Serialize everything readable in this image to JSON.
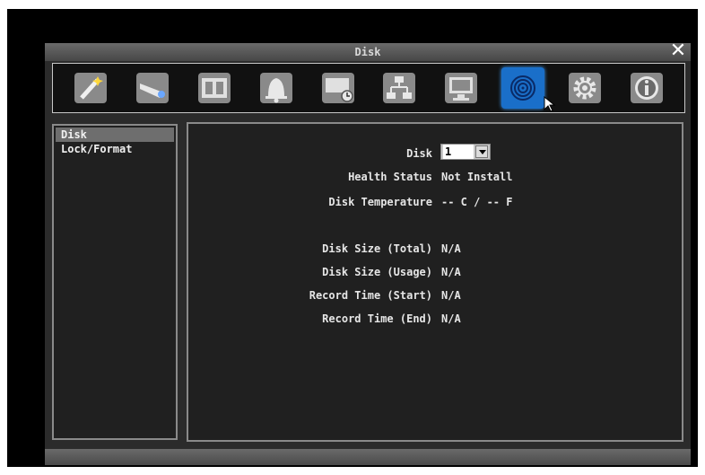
{
  "window": {
    "title": "Disk",
    "close_label": "✕"
  },
  "toolbar": {
    "icons": [
      "wizard-icon",
      "camera-icon",
      "film-icon",
      "alarm-bell-icon",
      "schedule-icon",
      "network-icon",
      "display-icon",
      "disk-icon",
      "gear-icon",
      "info-icon"
    ],
    "active": "disk-icon"
  },
  "sidebar": {
    "items": [
      {
        "label": "Disk",
        "selected": true
      },
      {
        "label": "Lock/Format",
        "selected": false
      }
    ]
  },
  "content": {
    "disk_label": "Disk",
    "disk_select_value": "1",
    "health_label": "Health Status",
    "health_value": "Not Install",
    "temp_label": "Disk Temperature",
    "temp_value": "-- C / -- F",
    "size_total_label": "Disk Size (Total)",
    "size_total_value": "N/A",
    "size_usage_label": "Disk Size (Usage)",
    "size_usage_value": "N/A",
    "record_start_label": "Record Time (Start)",
    "record_start_value": "N/A",
    "record_end_label": "Record Time (End)",
    "record_end_value": "N/A"
  },
  "colors": {
    "accent": "#1a6fc9",
    "panel": "#202020",
    "frame": "#8a8a8a"
  }
}
